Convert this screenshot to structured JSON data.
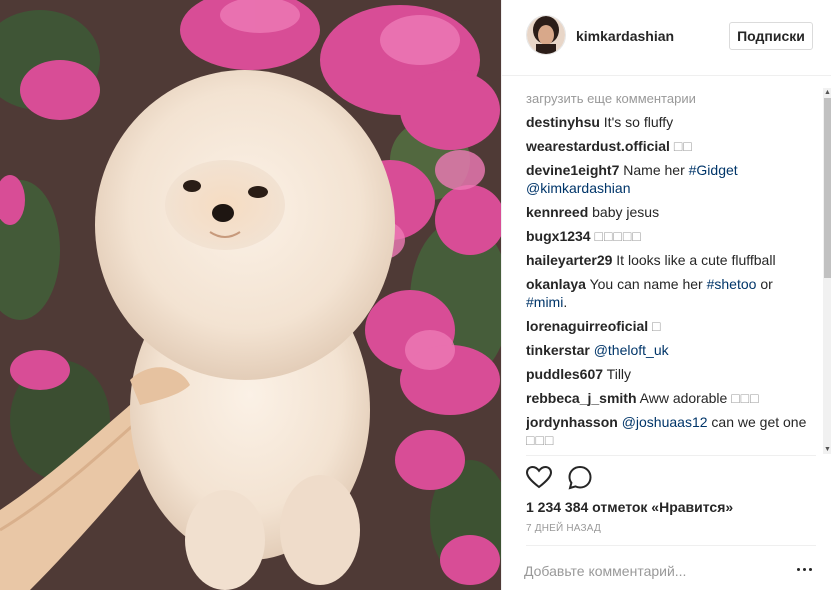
{
  "post": {
    "username": "kimkardashian",
    "follow_label": "Подписки",
    "load_more": "загрузить еще комментарии",
    "likes_text": "1 234 384 отметок «Нравится»",
    "time_text": "7 ДНЕЙ НАЗАД",
    "add_comment_placeholder": "Добавьте комментарий..."
  },
  "comments": [
    {
      "user": "destinyhsu",
      "text": "It's so fluffy"
    },
    {
      "user": "wearestardust.official",
      "text": "□□"
    },
    {
      "user": "devine1eight7",
      "text": "Name her",
      "tag1": "#Gidget",
      "tag2": "@kimkardashian"
    },
    {
      "user": "kennreed",
      "text": "baby jesus"
    },
    {
      "user": "bugx1234",
      "text": "□□□□□"
    },
    {
      "user": "haileyarter29",
      "text": "It looks like a cute fluffball"
    },
    {
      "user": "okanlaya",
      "text": "You can name her",
      "tag1": "#shetoo",
      "mid": "or",
      "tag2": "#mimi",
      "end": "."
    },
    {
      "user": "lorenaguirreoficial",
      "text": "□"
    },
    {
      "user": "tinkerstar",
      "tag1": "@theloft_uk"
    },
    {
      "user": "puddles607",
      "text": "Tilly"
    },
    {
      "user": "rebbeca_j_smith",
      "text": "Aww adorable",
      "extra": "□□□"
    },
    {
      "user": "jordynhasson",
      "tag1": "@joshuaas12",
      "text": "can we get one",
      "extra": "□□□"
    }
  ],
  "icons": {
    "like": "heart-icon",
    "comment": "comment-bubble-icon",
    "more": "more-options-icon"
  },
  "colors": {
    "link": "#003569",
    "muted": "#999999",
    "text": "#262626"
  }
}
